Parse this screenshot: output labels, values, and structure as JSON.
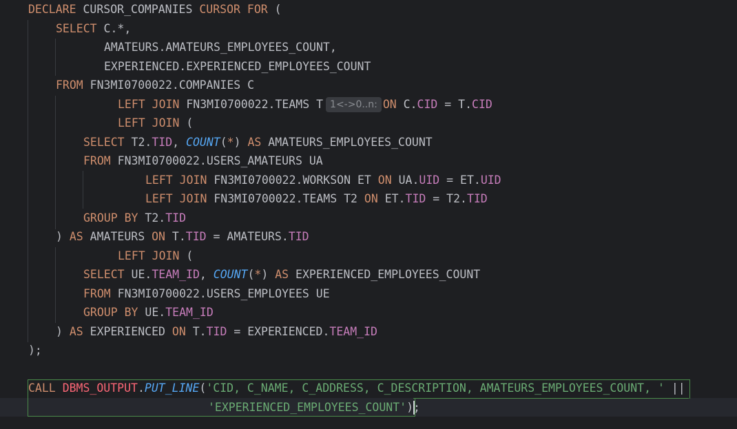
{
  "editor": {
    "language": "PL/SQL",
    "inlay_hint": "1<->0..n:",
    "lines": {
      "l1": {
        "a": "DECLARE",
        "b": " CURSOR_COMPANIES ",
        "c": "CURSOR",
        "d": " ",
        "e": "FOR",
        "f": " ("
      },
      "l2": {
        "a": "SELECT",
        "b": " C.*,"
      },
      "l3": {
        "a": "AMATEURS.AMATEURS_EMPLOYEES_COUNT,"
      },
      "l4": {
        "a": "EXPERIENCED.EXPERIENCED_EMPLOYEES_COUNT"
      },
      "l5": {
        "a": "FROM",
        "b": " FN3MI0700022.COMPANIES C"
      },
      "l6": {
        "a": "LEFT JOIN",
        "b": " FN3MI0700022.TEAMS T",
        "c": "ON",
        "d": " C.",
        "e": "CID",
        "f": " = T.",
        "g": "CID"
      },
      "l7": {
        "a": "LEFT JOIN",
        "b": " ("
      },
      "l8": {
        "a": "SELECT",
        "b": " T2.",
        "c": "TID",
        "d": ", ",
        "e": "COUNT",
        "f": "(",
        "g": "*",
        "h": ") ",
        "i": "AS",
        "j": " AMATEURS_EMPLOYEES_COUNT"
      },
      "l9": {
        "a": "FROM",
        "b": " FN3MI0700022.USERS_AMATEURS UA"
      },
      "l10": {
        "a": "LEFT JOIN",
        "b": " FN3MI0700022.WORKSON ET ",
        "c": "ON",
        "d": " UA.",
        "e": "UID",
        "f": " = ET.",
        "g": "UID"
      },
      "l11": {
        "a": "LEFT JOIN",
        "b": " FN3MI0700022.TEAMS T2 ",
        "c": "ON",
        "d": " ET.",
        "e": "TID",
        "f": " = T2.",
        "g": "TID"
      },
      "l12": {
        "a": "GROUP BY",
        "b": " T2.",
        "c": "TID"
      },
      "l13": {
        "a": ") ",
        "b": "AS",
        "c": " AMATEURS ",
        "d": "ON",
        "e": " T.",
        "f": "TID",
        "g": " = AMATEURS.",
        "h": "TID"
      },
      "l14": {
        "a": "LEFT JOIN",
        "b": " ("
      },
      "l15": {
        "a": "SELECT",
        "b": " UE.",
        "c": "TEAM_ID",
        "d": ", ",
        "e": "COUNT",
        "f": "(",
        "g": "*",
        "h": ") ",
        "i": "AS",
        "j": " EXPERIENCED_EMPLOYEES_COUNT"
      },
      "l16": {
        "a": "FROM",
        "b": " FN3MI0700022.USERS_EMPLOYEES UE"
      },
      "l17": {
        "a": "GROUP BY",
        "b": " UE.",
        "c": "TEAM_ID"
      },
      "l18": {
        "a": ") ",
        "b": "AS",
        "c": " EXPERIENCED ",
        "d": "ON",
        "e": " T.",
        "f": "TID",
        "g": " = EXPERIENCED.",
        "h": "TEAM_ID"
      },
      "l19": {
        "a": ");"
      },
      "l21": {
        "a": "CALL",
        "b": " ",
        "c": "DBMS_OUTPUT",
        "d": ".",
        "e": "PUT_LINE",
        "f": "(",
        "g": "'CID, C_NAME, C_ADDRESS, C_DESCRIPTION, AMATEURS_EMPLOYEES_COUNT, '",
        "h": " ||"
      },
      "l22": {
        "a": "'EXPERIENCED_EMPLOYEES_COUNT'",
        "b": ");"
      }
    },
    "colors": {
      "background": "#1e1f22",
      "keyword": "#cf8e6d",
      "column": "#c77dbb",
      "function": "#56a8f5",
      "string": "#6aab73",
      "package": "#fa6675",
      "text": "#bcbec4"
    }
  }
}
